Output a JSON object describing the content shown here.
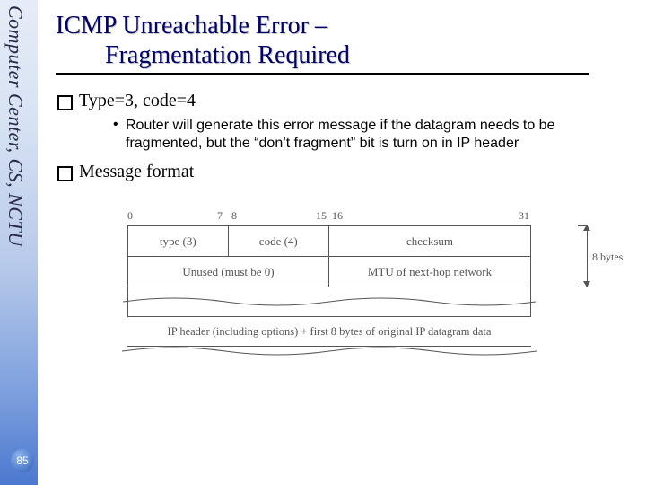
{
  "sidebar": {
    "org": "Computer Center, CS, NCTU"
  },
  "page_number": "85",
  "title": {
    "line1": "ICMP Unreachable Error –",
    "line2": "Fragmentation Required"
  },
  "bullets": {
    "b1": "Type=3, code=4",
    "b1_sub": "Router will generate this error message if the datagram needs to be fragmented, but the “don’t fragment” bit is turn on in IP header",
    "b2": "Message format"
  },
  "diagram": {
    "bits": {
      "b0": "0",
      "b7": "7",
      "b8": "8",
      "b15": "15",
      "b16": "16",
      "b31": "31"
    },
    "row1": {
      "type": "type (3)",
      "code": "code (4)",
      "checksum": "checksum"
    },
    "row2": {
      "unused": "Unused (must be 0)",
      "mtu": "MTU of next-hop network"
    },
    "row3": "IP header (including options) + first 8 bytes of original IP datagram data",
    "brace": "8 bytes"
  }
}
